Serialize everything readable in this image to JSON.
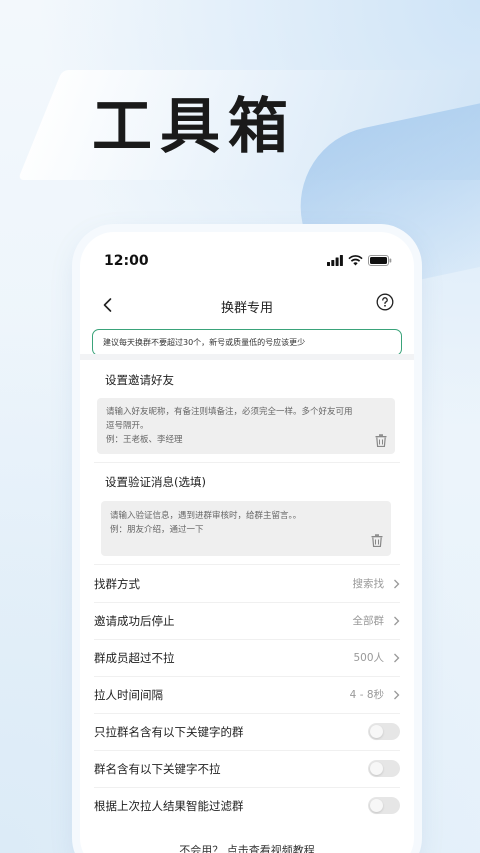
{
  "hero": {
    "title": "工具箱"
  },
  "status_bar": {
    "time": "12:00"
  },
  "nav": {
    "title": "换群专用"
  },
  "notice": "建议每天换群不要超过30个，新号或质量低的号应该更少",
  "invite_section": {
    "title": "设置邀请好友",
    "placeholder_line1": "请输入好友昵称，有备注则填备注，必须完全一样。多个好友可用",
    "placeholder_line2": "逗号隔开。",
    "placeholder_line3": "例：王老板、李经理"
  },
  "verify_section": {
    "title": "设置验证消息(选填)",
    "placeholder_line1": "请输入验证信息，遇到进群审核时，给群主留言。。",
    "placeholder_line2": "例：朋友介绍，通过一下"
  },
  "settings": [
    {
      "label": "找群方式",
      "value": "搜索找"
    },
    {
      "label": "邀请成功后停止",
      "value": "全部群"
    },
    {
      "label": "群成员超过不拉",
      "value": "500人"
    },
    {
      "label": "拉人时间间隔",
      "value": "4 - 8秒"
    }
  ],
  "toggles": [
    {
      "label": "只拉群名含有以下关键字的群",
      "on": false
    },
    {
      "label": "群名含有以下关键字不拉",
      "on": false
    },
    {
      "label": "根据上次拉人结果智能过滤群",
      "on": false
    }
  ],
  "footer": "不会用？ 点击查看视频教程",
  "colors": {
    "accent_border": "#3aa37a",
    "background": "#eaf3fb"
  }
}
